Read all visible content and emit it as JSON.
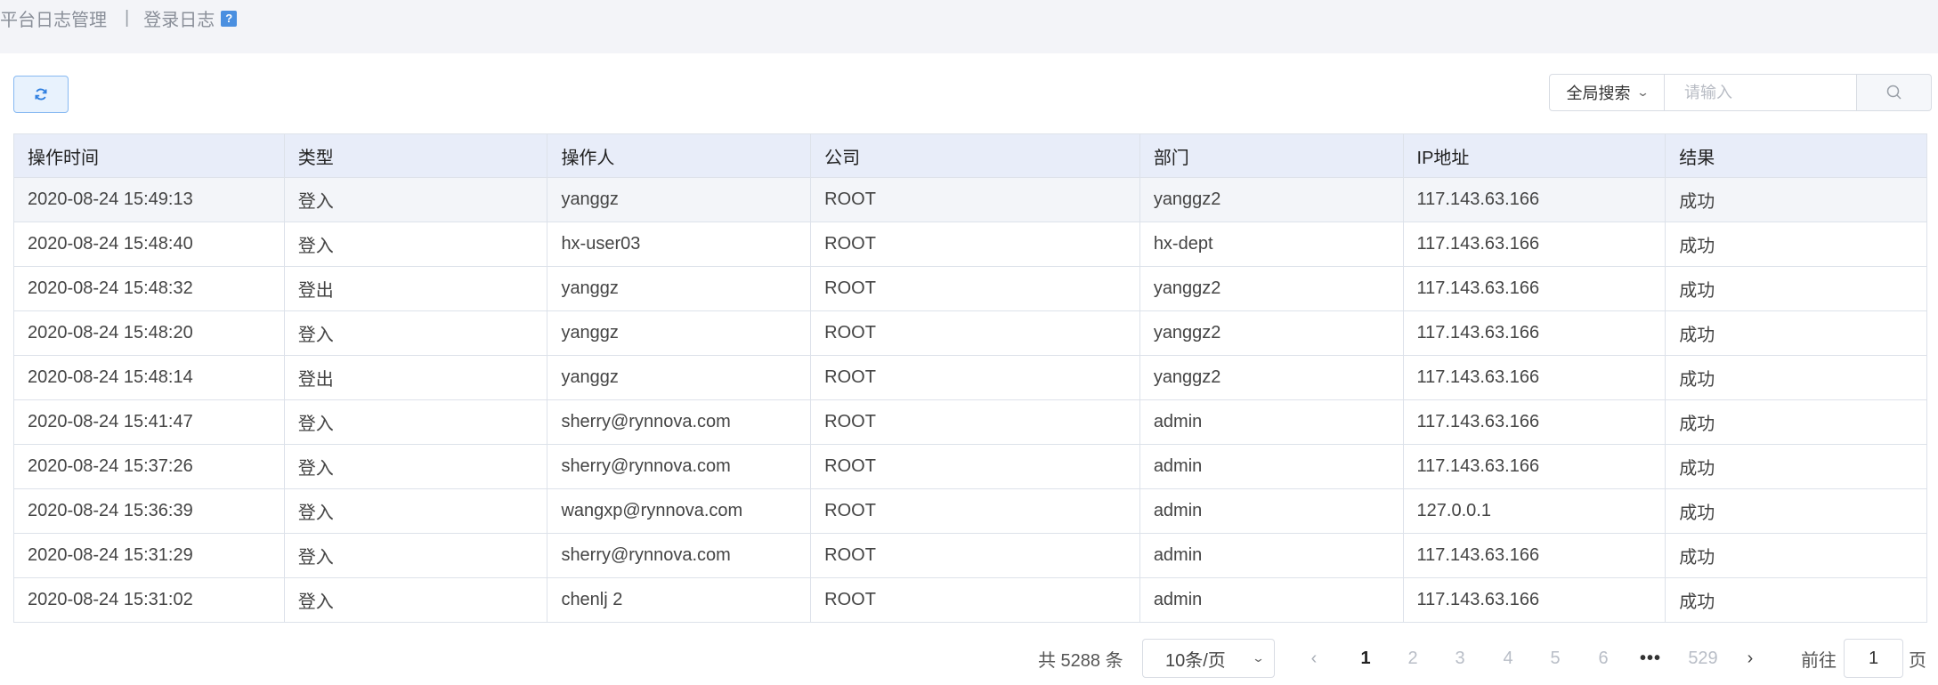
{
  "breadcrumb": {
    "parent": "平台日志管理",
    "separator": "|",
    "current": "登录日志",
    "help": "?"
  },
  "toolbar": {
    "refresh_icon": "refresh-icon",
    "search_scope": "全局搜索",
    "search_placeholder": "请输入",
    "search_value": "",
    "search_icon": "search-icon"
  },
  "table": {
    "columns": [
      "操作时间",
      "类型",
      "操作人",
      "公司",
      "部门",
      "IP地址",
      "结果"
    ],
    "rows": [
      [
        "2020-08-24 15:49:13",
        "登入",
        "yanggz",
        "ROOT",
        "yanggz2",
        "117.143.63.166",
        "成功"
      ],
      [
        "2020-08-24 15:48:40",
        "登入",
        "hx-user03",
        "ROOT",
        "hx-dept",
        "117.143.63.166",
        "成功"
      ],
      [
        "2020-08-24 15:48:32",
        "登出",
        "yanggz",
        "ROOT",
        "yanggz2",
        "117.143.63.166",
        "成功"
      ],
      [
        "2020-08-24 15:48:20",
        "登入",
        "yanggz",
        "ROOT",
        "yanggz2",
        "117.143.63.166",
        "成功"
      ],
      [
        "2020-08-24 15:48:14",
        "登出",
        "yanggz",
        "ROOT",
        "yanggz2",
        "117.143.63.166",
        "成功"
      ],
      [
        "2020-08-24 15:41:47",
        "登入",
        "sherry@rynnova.com",
        "ROOT",
        "admin",
        "117.143.63.166",
        "成功"
      ],
      [
        "2020-08-24 15:37:26",
        "登入",
        "sherry@rynnova.com",
        "ROOT",
        "admin",
        "117.143.63.166",
        "成功"
      ],
      [
        "2020-08-24 15:36:39",
        "登入",
        "wangxp@rynnova.com",
        "ROOT",
        "admin",
        "127.0.0.1",
        "成功"
      ],
      [
        "2020-08-24 15:31:29",
        "登入",
        "sherry@rynnova.com",
        "ROOT",
        "admin",
        "117.143.63.166",
        "成功"
      ],
      [
        "2020-08-24 15:31:02",
        "登入",
        "chenlj 2",
        "ROOT",
        "admin",
        "117.143.63.166",
        "成功"
      ]
    ]
  },
  "pagination": {
    "total_text": "共 5288 条",
    "page_size": "10条/页",
    "pages": [
      "1",
      "2",
      "3",
      "4",
      "5",
      "6"
    ],
    "ellipsis": "•••",
    "last_page": "529",
    "current_page": "1",
    "goto_label": "前往",
    "goto_value": "1",
    "page_unit": "页"
  },
  "colors": {
    "accent": "#2f7fe0",
    "header_bg": "#e8edf9",
    "topbar_bg": "#f3f4f8"
  }
}
